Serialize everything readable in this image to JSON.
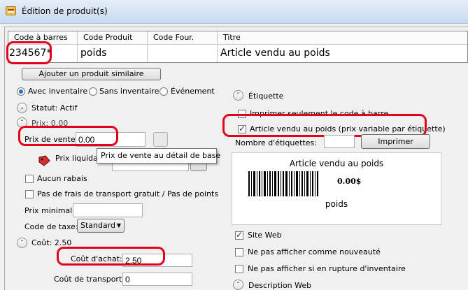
{
  "window": {
    "title": "Édition de produit(s)"
  },
  "grid": {
    "headers": [
      "Code à barres",
      "Code Produit",
      "Code Four.",
      "Titre"
    ],
    "row": [
      "234567*",
      "poids",
      "",
      "Article vendu au poids"
    ]
  },
  "buttons": {
    "add_similar": "Ajouter un produit similaire",
    "print": "Imprimer"
  },
  "inventory": {
    "options": [
      "Avec inventaire",
      "Sans inventaire",
      "Événement"
    ],
    "selected": "Avec inventaire"
  },
  "status": {
    "label": "Statut: Actif"
  },
  "price": {
    "section_label": "Prix: 0.00",
    "sale_label": "Prix de vente:",
    "sale_value": "0.00",
    "liquidation_label": "Prix liquidat",
    "tooltip": "Prix de vente au détail de base",
    "no_discount": "Aucun rabais",
    "no_free_shipping": "Pas de frais de transport gratuit / Pas de points",
    "min_price_label": "Prix minimal:",
    "min_price_value": "",
    "tax_code_label": "Code de taxe:",
    "tax_code_value": "Standard"
  },
  "cost": {
    "section_label": "Coût: 2.50",
    "purchase_label": "Coût d'achat:",
    "purchase_value": "2.50",
    "transport_label": "Coût de transport:",
    "transport_value": "0"
  },
  "label_section": {
    "title": "Étiquette",
    "print_barcode_only": "Imprimer seulement le code à barre",
    "weighted": "Article vendu au poids (prix variable par étiquette)",
    "count_label": "Nombre d'étiquettes:",
    "count_value": "",
    "preview_title": "Article vendu au poids",
    "preview_price": "0.00$",
    "preview_code": "poids"
  },
  "web": {
    "site_web": "Site Web",
    "not_new": "Ne pas afficher comme nouveauté",
    "not_out_of_stock": "Ne pas afficher si en rupture d'inventaire",
    "description": "Description Web"
  },
  "colors": {
    "highlight": "#e2001a",
    "accent": "#2b6ec9"
  }
}
